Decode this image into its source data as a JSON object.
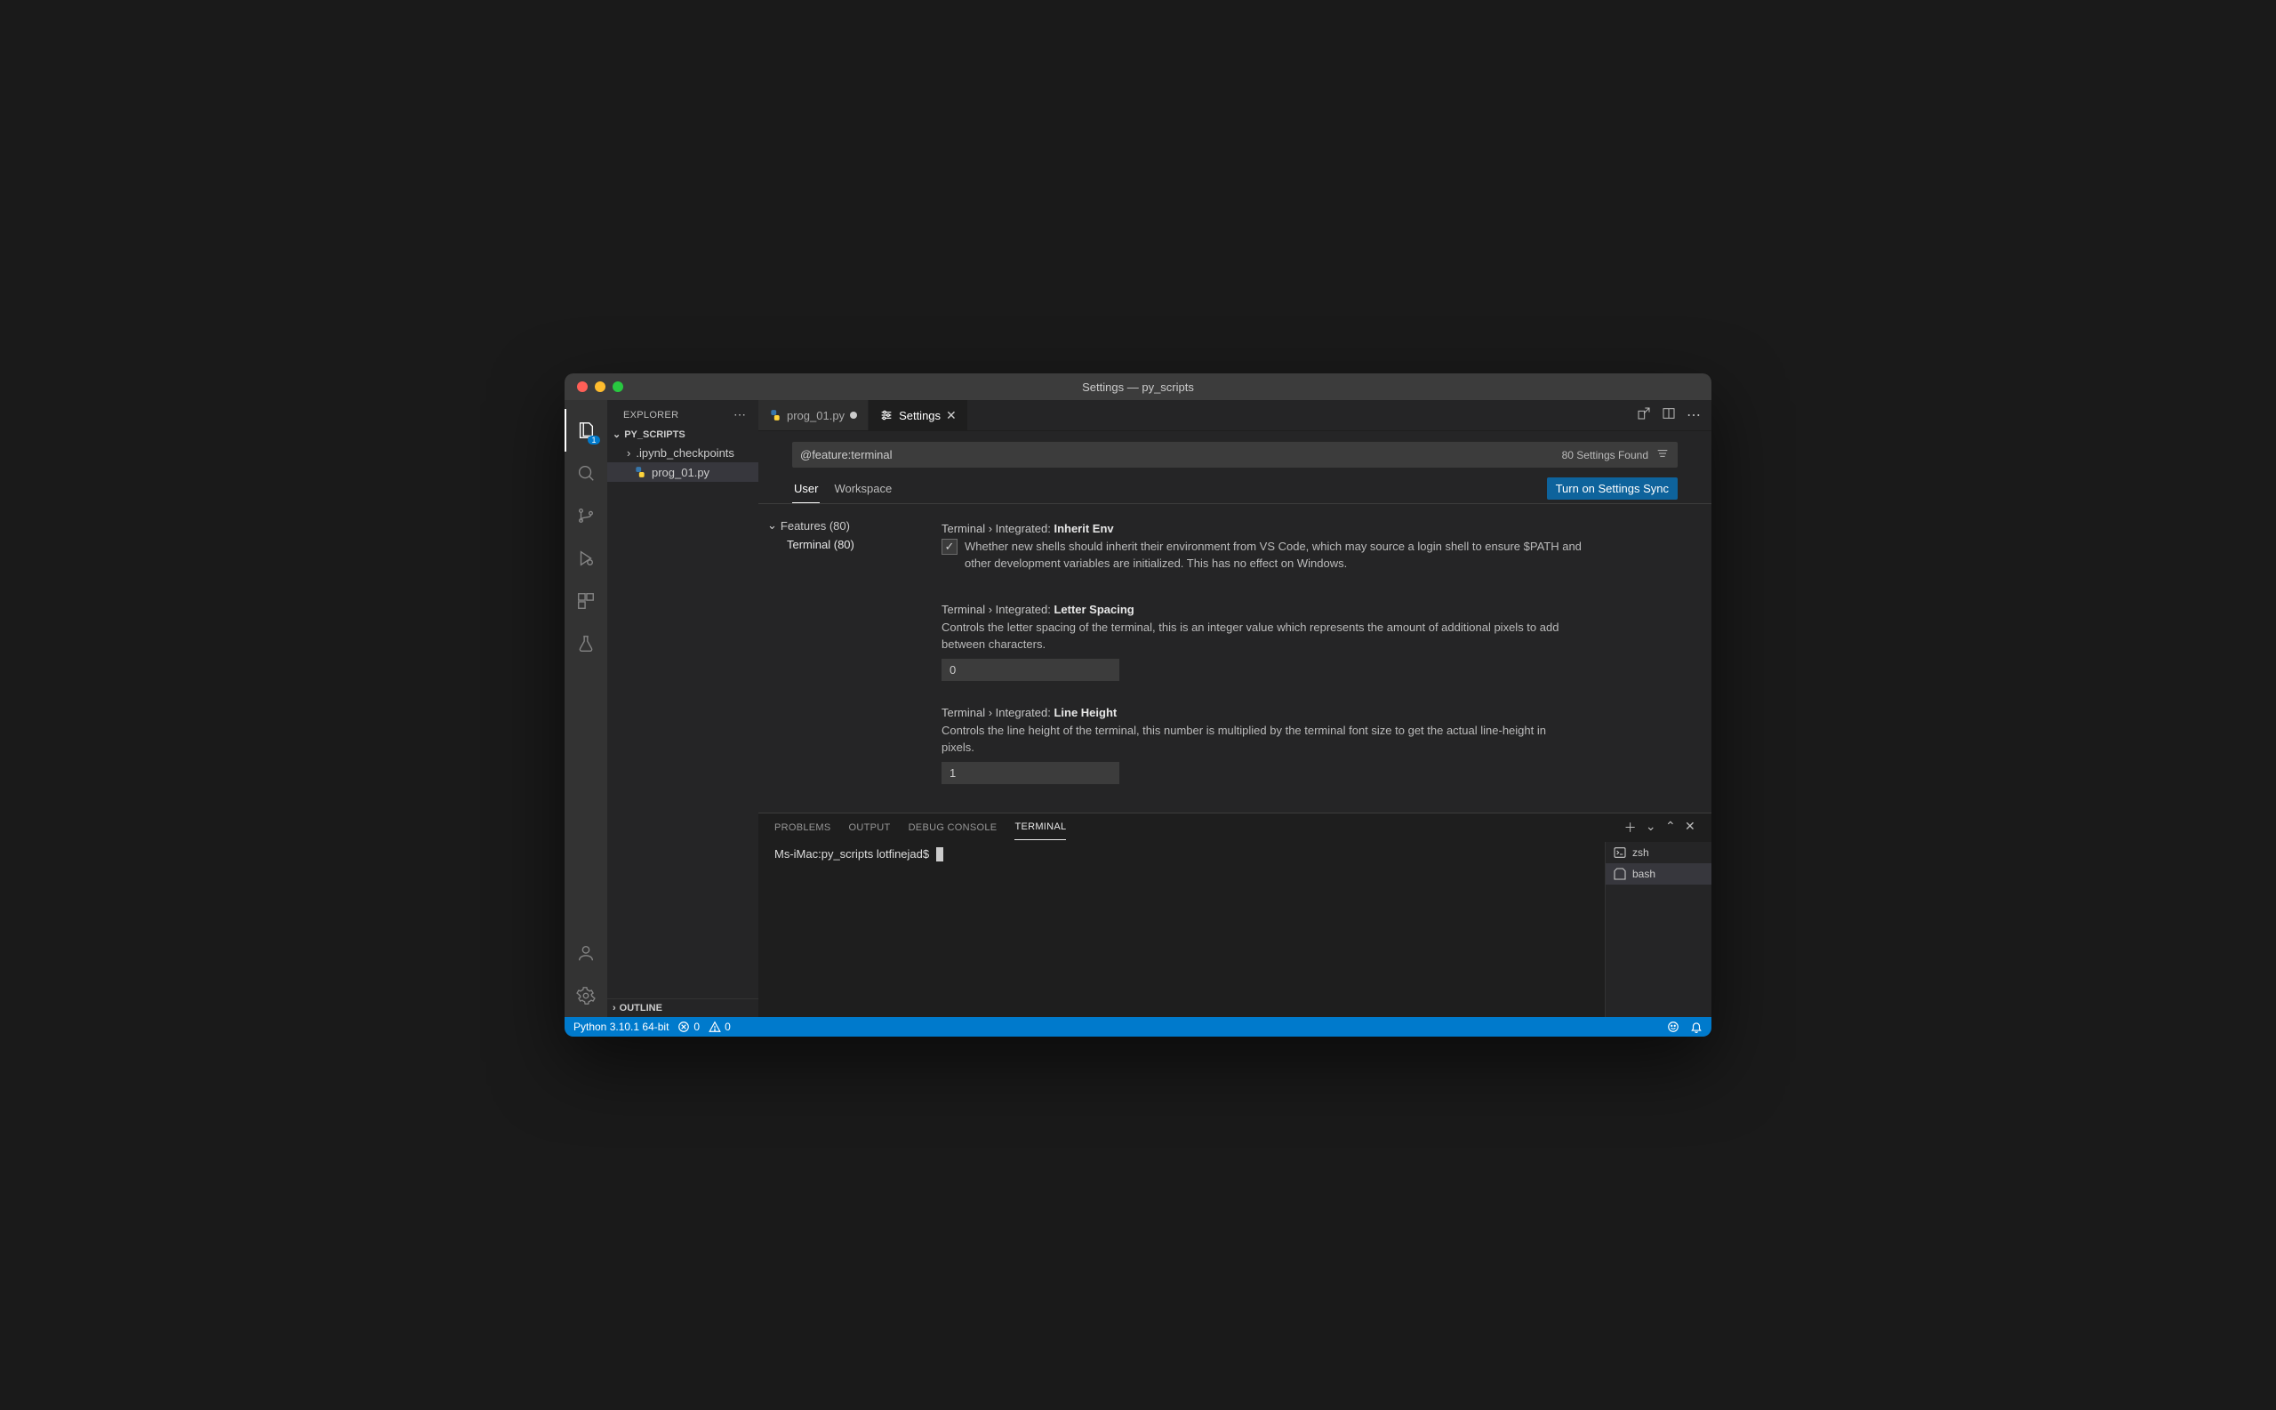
{
  "titlebar": {
    "title": "Settings — py_scripts"
  },
  "activitybar": {
    "explorer_badge": "1"
  },
  "sidebar": {
    "header": "EXPLORER",
    "project": "PY_SCRIPTS",
    "items": [
      {
        "label": ".ipynb_checkpoints"
      },
      {
        "label": "prog_01.py"
      }
    ],
    "outline": "OUTLINE"
  },
  "tabs": {
    "file_tab": "prog_01.py",
    "settings_tab": "Settings"
  },
  "settings": {
    "search_value": "@feature:terminal",
    "count_text": "80 Settings Found",
    "scope_user": "User",
    "scope_workspace": "Workspace",
    "sync_button": "Turn on Settings Sync",
    "toc": {
      "features": "Features (80)",
      "terminal": "Terminal (80)"
    },
    "items": [
      {
        "crumb": "Terminal › Integrated: ",
        "name": "Inherit Env",
        "type": "checkbox",
        "checked": true,
        "desc": "Whether new shells should inherit their environment from VS Code, which may source a login shell to ensure $PATH and other development variables are initialized. This has no effect on Windows."
      },
      {
        "crumb": "Terminal › Integrated: ",
        "name": "Letter Spacing",
        "type": "number",
        "value": "0",
        "desc": "Controls the letter spacing of the terminal, this is an integer value which represents the amount of additional pixels to add between characters."
      },
      {
        "crumb": "Terminal › Integrated: ",
        "name": "Line Height",
        "type": "number",
        "value": "1",
        "desc": "Controls the line height of the terminal, this number is multiplied by the terminal font size to get the actual line-height in pixels."
      }
    ]
  },
  "panel": {
    "tabs": {
      "problems": "PROBLEMS",
      "output": "OUTPUT",
      "debug": "DEBUG CONSOLE",
      "terminal": "TERMINAL"
    },
    "prompt": "Ms-iMac:py_scripts lotfinejad$",
    "shells": [
      {
        "name": "zsh"
      },
      {
        "name": "bash"
      }
    ]
  },
  "status": {
    "python": "Python 3.10.1 64-bit",
    "errors": "0",
    "warnings": "0"
  }
}
